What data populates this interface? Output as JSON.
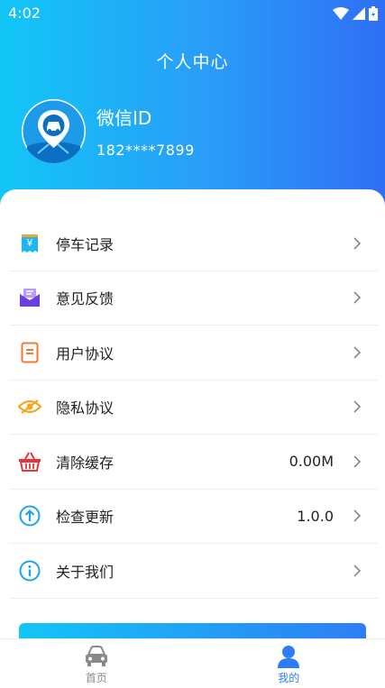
{
  "status_bar": {
    "time": "4:02"
  },
  "header": {
    "title": "个人中心",
    "username": "微信ID",
    "phone": "182****7899"
  },
  "menu": {
    "items": [
      {
        "label": "停车记录",
        "value": "",
        "icon": "parking-receipt-icon"
      },
      {
        "label": "意见反馈",
        "value": "",
        "icon": "feedback-mail-icon"
      },
      {
        "label": "用户协议",
        "value": "",
        "icon": "document-icon"
      },
      {
        "label": "隐私协议",
        "value": "",
        "icon": "eye-hidden-icon"
      },
      {
        "label": "清除缓存",
        "value": "0.00M",
        "icon": "basket-icon"
      },
      {
        "label": "检查更新",
        "value": "1.0.0",
        "icon": "upload-arrow-icon"
      },
      {
        "label": "关于我们",
        "value": "",
        "icon": "info-icon"
      }
    ]
  },
  "tabbar": {
    "tabs": [
      {
        "label": "首页",
        "icon": "car-icon",
        "active": false
      },
      {
        "label": "我的",
        "icon": "user-icon",
        "active": true
      }
    ]
  },
  "colors": {
    "gradient_start": "#12c6f6",
    "gradient_end": "#2f6ff6",
    "active_tab": "#2f7df6"
  }
}
